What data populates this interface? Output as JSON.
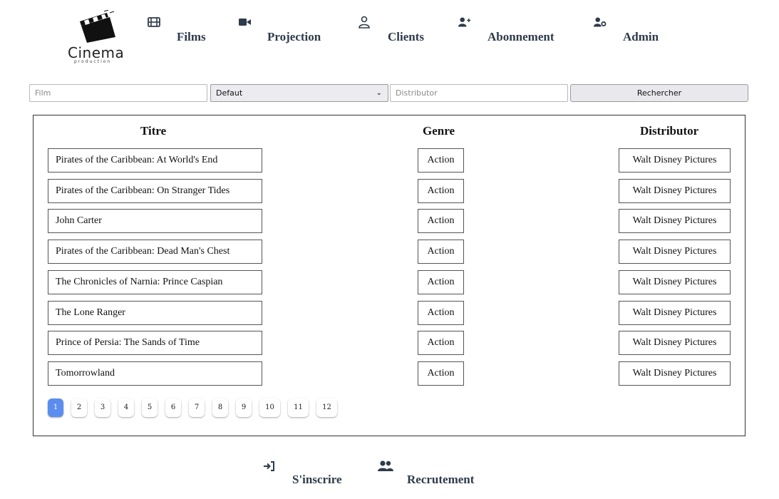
{
  "logo": {
    "title": "Cinema",
    "subtitle": "production"
  },
  "nav": [
    {
      "label": "Films",
      "icon": "film-icon"
    },
    {
      "label": "Projection",
      "icon": "video-camera-icon"
    },
    {
      "label": "Clients",
      "icon": "user-icon"
    },
    {
      "label": "Abonnement",
      "icon": "user-plus-icon"
    },
    {
      "label": "Admin",
      "icon": "user-gear-icon"
    }
  ],
  "search": {
    "film_placeholder": "Film",
    "genre_selected": "Defaut",
    "distributor_placeholder": "Distributor",
    "button_label": "Rechercher"
  },
  "table": {
    "headers": {
      "title": "Titre",
      "genre": "Genre",
      "distributor": "Distributor"
    },
    "rows": [
      {
        "title": "Pirates of the Caribbean: At World's End",
        "genre": "Action",
        "distributor": "Walt Disney Pictures"
      },
      {
        "title": "Pirates of the Caribbean: On Stranger Tides",
        "genre": "Action",
        "distributor": "Walt Disney Pictures"
      },
      {
        "title": "John Carter",
        "genre": "Action",
        "distributor": "Walt Disney Pictures"
      },
      {
        "title": "Pirates of the Caribbean: Dead Man's Chest",
        "genre": "Action",
        "distributor": "Walt Disney Pictures"
      },
      {
        "title": "The Chronicles of Narnia: Prince Caspian",
        "genre": "Action",
        "distributor": "Walt Disney Pictures"
      },
      {
        "title": "The Lone Ranger",
        "genre": "Action",
        "distributor": "Walt Disney Pictures"
      },
      {
        "title": "Prince of Persia: The Sands of Time",
        "genre": "Action",
        "distributor": "Walt Disney Pictures"
      },
      {
        "title": "Tomorrowland",
        "genre": "Action",
        "distributor": "Walt Disney Pictures"
      }
    ]
  },
  "pagination": {
    "pages": [
      "1",
      "2",
      "3",
      "4",
      "5",
      "6",
      "7",
      "8",
      "9",
      "10",
      "11",
      "12"
    ],
    "current": "1"
  },
  "footer": [
    {
      "label": "S'inscrire",
      "icon": "sign-in-icon"
    },
    {
      "label": "Recrutement",
      "icon": "users-icon"
    }
  ],
  "colors": {
    "nav_text": "#2d3b4a",
    "active_page": "#5b8def"
  }
}
